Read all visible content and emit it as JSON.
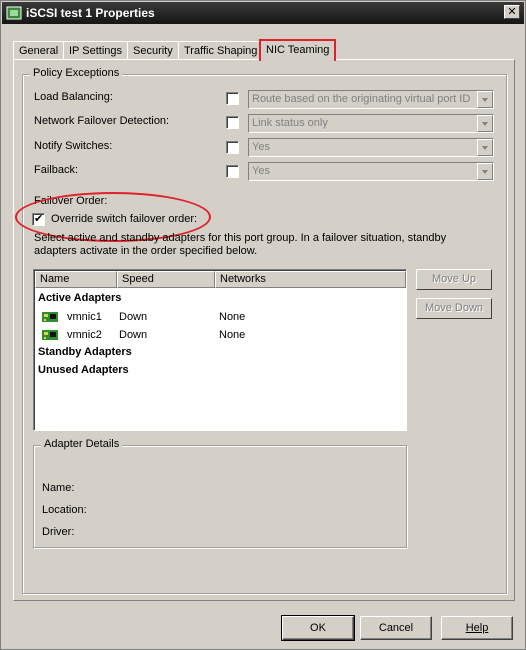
{
  "window": {
    "title": "iSCSI test 1 Properties"
  },
  "tabs": [
    {
      "label": "General"
    },
    {
      "label": "IP Settings"
    },
    {
      "label": "Security"
    },
    {
      "label": "Traffic Shaping"
    },
    {
      "label": "NIC Teaming",
      "selected": true
    }
  ],
  "policy_exceptions": {
    "legend": "Policy Exceptions",
    "rows": [
      {
        "label": "Load Balancing:",
        "checked": false,
        "value": "Route based on the originating virtual port ID"
      },
      {
        "label": "Network Failover Detection:",
        "checked": false,
        "value": "Link status only"
      },
      {
        "label": "Notify Switches:",
        "checked": false,
        "value": "Yes"
      },
      {
        "label": "Failback:",
        "checked": false,
        "value": "Yes"
      }
    ]
  },
  "failover": {
    "heading": "Failover Order:",
    "override_label": "Override switch failover order:",
    "override_checked": true,
    "description_line1": "Select active and standby adapters for this port group.  In a failover situation, standby",
    "description_line2": "adapters activate  in the order specified below."
  },
  "adapter_list": {
    "columns": [
      "Name",
      "Speed",
      "Networks"
    ],
    "groups": {
      "active": "Active Adapters",
      "standby": "Standby Adapters",
      "unused": "Unused Adapters"
    },
    "active_rows": [
      {
        "name": "vmnic1",
        "speed": "Down",
        "networks": "None",
        "icon": "nic-icon"
      },
      {
        "name": "vmnic2",
        "speed": "Down",
        "networks": "None",
        "icon": "nic-icon"
      }
    ]
  },
  "side_buttons": {
    "move_up": "Move Up",
    "move_down": "Move Down"
  },
  "adapter_details": {
    "legend": "Adapter Details",
    "name_label": "Name:",
    "location_label": "Location:",
    "driver_label": "Driver:"
  },
  "buttons": {
    "ok": "OK",
    "cancel": "Cancel",
    "help": "Help"
  },
  "colors": {
    "highlight": "#e0202a",
    "dialog_bg": "#d4d0c8",
    "title_bg": "#151515"
  }
}
